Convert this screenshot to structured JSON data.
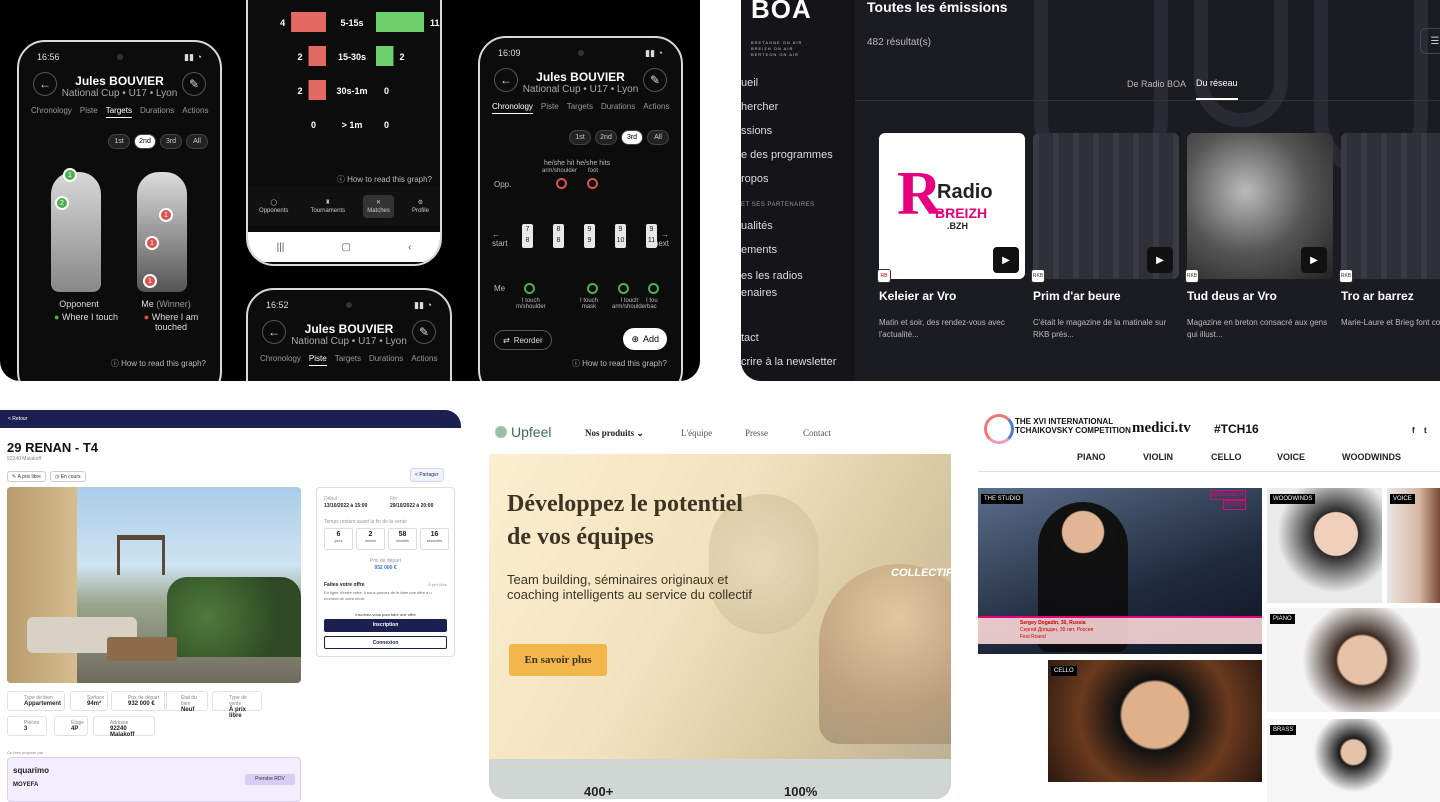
{
  "fencing": {
    "phone1": {
      "time": "16:56",
      "title": "Jules BOUVIER",
      "subtitle": "National Cup • U17 • Lyon",
      "tabs": [
        "Chronology",
        "Piste",
        "Targets",
        "Durations",
        "Actions"
      ],
      "active_tab": "Targets",
      "periods": [
        "1st",
        "2nd",
        "3rd",
        "All"
      ],
      "opponent_label": "Opponent",
      "opponent_legend": "Where I touch",
      "me_label": "Me",
      "me_winner": "(Winner)",
      "me_legend": "Where I am touched",
      "how_to_read": "How to read this graph?",
      "opp_dots": [
        "1",
        "2"
      ],
      "me_dots": [
        "1",
        "1",
        "1"
      ]
    },
    "phone2": {
      "rows": [
        {
          "left": "4",
          "range": "5-15s",
          "right": "11"
        },
        {
          "left": "2",
          "range": "15-30s",
          "right": "2"
        },
        {
          "left": "2",
          "range": "30s-1m",
          "right": "0"
        },
        {
          "left": "0",
          "range": "> 1m",
          "right": "0"
        }
      ],
      "bar_values_left": [
        4,
        2,
        2,
        0
      ],
      "bar_values_right": [
        11,
        2,
        0,
        0
      ],
      "how_to_read": "How to read this graph?",
      "nav": [
        "Opponents",
        "Tournaments",
        "Matches",
        "Profile"
      ],
      "active_nav": "Matches"
    },
    "phone3": {
      "time": "16:52",
      "title": "Jules BOUVIER",
      "subtitle": "National Cup • U17 • Lyon",
      "tabs": [
        "Chronology",
        "Piste",
        "Targets",
        "Durations",
        "Actions"
      ],
      "active_tab": "Piste"
    },
    "phone4": {
      "time": "16:09",
      "title": "Jules BOUVIER",
      "subtitle": "National Cup • U17 • Lyon",
      "tabs": [
        "Chronology",
        "Piste",
        "Targets",
        "Durations",
        "Actions"
      ],
      "active_tab": "Chronology",
      "periods": [
        "1st",
        "2nd",
        "3rd",
        "All"
      ],
      "hits_header": "he/she hit",
      "hits_header2": "he/she hits",
      "opp_label": "Opp.",
      "me_label": "Me",
      "top_tags": [
        "arm/shoulder",
        "foot"
      ],
      "scores": [
        [
          "7",
          "8"
        ],
        [
          "8",
          "8"
        ],
        [
          "9",
          "9"
        ],
        [
          "9",
          "10"
        ],
        [
          "9",
          "11"
        ]
      ],
      "start": "start",
      "next": "next",
      "bottom_tags": [
        {
          "a": "I touch",
          "b": "m/shoulder"
        },
        {
          "a": "I touch",
          "b": "mask"
        },
        {
          "a": "I touch",
          "b": "arm/shoulder"
        },
        {
          "a": "I tou",
          "b": "bac"
        }
      ],
      "reorder": "Reorder",
      "add": "Add",
      "how_to_read": "How to read this graph?"
    }
  },
  "boa": {
    "logo": "BOA",
    "tagline": [
      "BRETAGNE ON AIR",
      "BREIZH ON AIR",
      "BERTEGN ON AIR"
    ],
    "nav": [
      "ueil",
      "hercher",
      "ssions",
      "e des programmes",
      "ropos"
    ],
    "section": "ET SES PARTENAIRES",
    "nav2": [
      "ualités",
      "ements",
      "es les radios",
      "enaires",
      "",
      "tact",
      "crire à la newsletter"
    ],
    "title": "Toutes les émissions",
    "count": "482 résultat(s)",
    "tabs": [
      "De Radio BOA",
      "Du réseau"
    ],
    "active_tab": "Du réseau",
    "cards": [
      {
        "title": "Keleier ar Vro",
        "desc": "Matin et soir, des rendez-vous avec l'actualité...",
        "logo_line1": "Radio",
        "logo_line2": "BREIZH",
        "logo_line3": ".BZH",
        "badge": "RB"
      },
      {
        "title": "Prim d'ar beure",
        "desc": "C'était le magazine de la matinale sur RKB prés...",
        "badge": "RKB"
      },
      {
        "title": "Tud deus ar Vro",
        "desc": "Magazine en breton consacré aux gens qui illust...",
        "badge": "RKB"
      },
      {
        "title": "Tro ar barrez",
        "desc": "Marie-Laure et Brieg font communes ...",
        "badge": "RKB"
      }
    ],
    "colors": {
      "accent": "#e6007e"
    }
  },
  "realestate": {
    "back": "< Retour",
    "title": "29 RENAN - T4",
    "address": "92240 Malakoff",
    "chips": [
      "A prix libre",
      "En cours"
    ],
    "share": "Partager",
    "debut_label": "Début",
    "debut_value": "13/10/2022 à 15:00",
    "fin_label": "Fin",
    "fin_value": "29/10/2022 à 20:00",
    "remaining_label": "Temps restant avant la fin de la vente",
    "countdown": [
      {
        "v": "6",
        "l": "jours"
      },
      {
        "v": "2",
        "l": "heures"
      },
      {
        "v": "58",
        "l": "minutes"
      },
      {
        "v": "16",
        "l": "secondes"
      }
    ],
    "price_label": "Prix de départ",
    "price_value": "932 000 €",
    "offer_title": "Faites votre offre",
    "offer_tag": "À prix libre",
    "offer_text": "En ligne d'entre votre, il nous pouvez de le faire une offre a u moment de votre choix",
    "signup_prompt": "Inscrivez-vous pour faire une offre",
    "signup_button": "Inscription",
    "login_button": "Connexion",
    "infos": [
      {
        "l": "Type de bien",
        "v": "Appartement"
      },
      {
        "l": "Surface",
        "v": "94m²"
      },
      {
        "l": "Prix de départ",
        "v": "932 000 €"
      },
      {
        "l": "État du bien",
        "v": "Neuf"
      },
      {
        "l": "Type de vente",
        "v": "À prix libre"
      },
      {
        "l": "Pièces",
        "v": "3"
      },
      {
        "l": "Étage",
        "v": "4P"
      },
      {
        "l": "Adresse",
        "v": "92240 Malakoff"
      }
    ],
    "agent_label": "Ce bien proposé par :",
    "agent_logo": "squarimo",
    "agent_name": "MOYEFA",
    "rdv": "Prendre RDV"
  },
  "upfeel": {
    "logo": "Upfeel",
    "nav": [
      "Nos produits",
      "L'équipe",
      "Presse",
      "Contact"
    ],
    "headline1": "Développez le potentiel",
    "headline2": "de vos équipes",
    "sub1": "Team building, séminaires originaux et",
    "sub2": "coaching intelligents au service du collectif",
    "cta": "En savoir plus",
    "sign": "COLLECTIF",
    "stats": [
      "400+",
      "100%"
    ],
    "colors": {
      "cta": "#f2b64a"
    }
  },
  "medici": {
    "competition1": "THE XVI INTERNATIONAL",
    "competition2": "TCHAIKOVSKY COMPETITION",
    "brand": "medici.tv",
    "hashtag": "#TCH16",
    "social": [
      "f",
      "t"
    ],
    "menu": [
      "PIANO",
      "VIOLIN",
      "CELLO",
      "VOICE",
      "WOODWINDS"
    ],
    "tiles": [
      "THE STUDIO",
      "WOODWINDS",
      "VOICE",
      "PIANO",
      "CELLO",
      "BRASS"
    ],
    "overlay_tag1": "tch16medici.tv",
    "overlay_tag2": "#TCH16",
    "caption1": "Sergey Dogadin, 30, Russia",
    "caption2": "Сергей Догадин, 30 лет, Россия",
    "caption3": "First Round"
  }
}
